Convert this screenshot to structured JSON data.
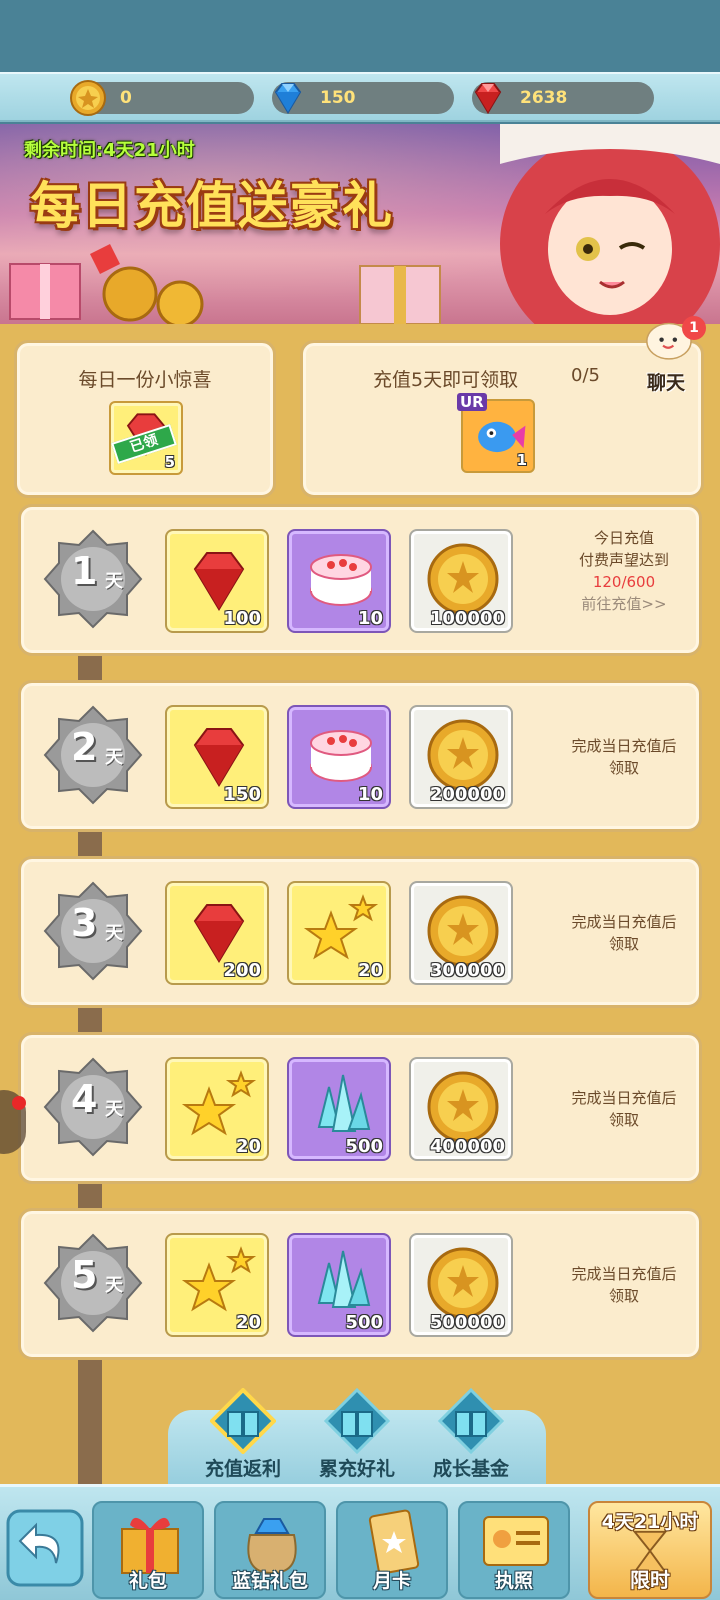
{
  "currency": {
    "gold": "0",
    "blue_diamond": "150",
    "red_diamond": "2638"
  },
  "banner": {
    "timer": "剩余时间:4天21小时",
    "title": "每日充值送豪礼"
  },
  "daily_surprise": {
    "title": "每日一份小惊喜",
    "claimed_tag": "已领",
    "count": "5"
  },
  "five_day_reward": {
    "title": "充值5天即可领取",
    "progress": "0/5",
    "badge": "UR",
    "count": "1"
  },
  "chat": {
    "label": "聊天",
    "unread": "1"
  },
  "day_unit": "天",
  "days": [
    {
      "day": "1",
      "items": [
        {
          "icon": "ruby-icon",
          "count": "100"
        },
        {
          "icon": "cake-icon",
          "count": "10"
        },
        {
          "icon": "gold-coin-icon",
          "count": "100000"
        }
      ],
      "status_line1": "今日充值",
      "status_line2": "付费声望达到",
      "status_progress": "120/600",
      "status_link": "前往充值>>"
    },
    {
      "day": "2",
      "items": [
        {
          "icon": "ruby-icon",
          "count": "150"
        },
        {
          "icon": "cake-icon",
          "count": "10"
        },
        {
          "icon": "gold-coin-icon",
          "count": "200000"
        }
      ],
      "status_line1": "完成当日充值后",
      "status_line2": "领取"
    },
    {
      "day": "3",
      "items": [
        {
          "icon": "ruby-icon",
          "count": "200"
        },
        {
          "icon": "stars-icon",
          "count": "20"
        },
        {
          "icon": "gold-coin-icon",
          "count": "300000"
        }
      ],
      "status_line1": "完成当日充值后",
      "status_line2": "领取"
    },
    {
      "day": "4",
      "items": [
        {
          "icon": "stars-icon",
          "count": "20"
        },
        {
          "icon": "crystal-icon",
          "count": "500"
        },
        {
          "icon": "gold-coin-icon",
          "count": "400000"
        }
      ],
      "status_line1": "完成当日充值后",
      "status_line2": "领取"
    },
    {
      "day": "5",
      "items": [
        {
          "icon": "stars-icon",
          "count": "20"
        },
        {
          "icon": "crystal-icon",
          "count": "500"
        },
        {
          "icon": "gold-coin-icon",
          "count": "500000"
        }
      ],
      "status_line1": "完成当日充值后",
      "status_line2": "领取"
    }
  ],
  "tabs": [
    {
      "label": "充值返利",
      "active": true
    },
    {
      "label": "累充好礼",
      "active": false
    },
    {
      "label": "成长基金",
      "active": false
    }
  ],
  "bottom_nav": [
    {
      "label": "礼包"
    },
    {
      "label": "蓝钻礼包"
    },
    {
      "label": "月卡"
    },
    {
      "label": "执照"
    }
  ],
  "limited": {
    "timer": "4天21小时",
    "label": "限时"
  },
  "colors": {
    "panel_bg": "#e2b85a",
    "card_bg": "#fbeccd",
    "tab_blue": "#bfe6ef",
    "accent_red": "#e83d3d"
  }
}
